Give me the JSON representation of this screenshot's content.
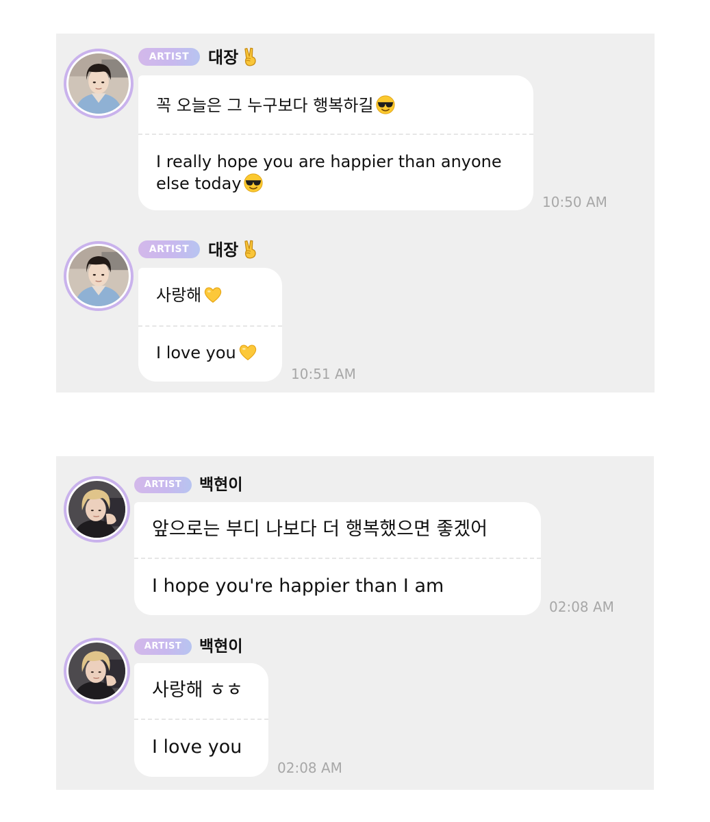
{
  "messages": [
    {
      "badge": "ARTIST",
      "name": "대장",
      "korean": "꼭 오늘은 그 누구보다 행복하길",
      "english": "I really hope you are happier than anyone else today",
      "time": "10:50 AM",
      "name_emoji": "victory-hand-emoji",
      "text_emoji": "sunglasses-face-emoji"
    },
    {
      "badge": "ARTIST",
      "name": "대장",
      "korean": "사랑해",
      "english": "I love you",
      "time": "10:51 AM",
      "name_emoji": "victory-hand-emoji",
      "text_emoji": "yellow-heart-emoji"
    },
    {
      "badge": "ARTIST",
      "name": "백현이",
      "korean": "앞으로는 부디 나보다 더 행복했으면 좋겠어",
      "english": "I hope you're happier than I am",
      "time": "02:08 AM"
    },
    {
      "badge": "ARTIST",
      "name": "백현이",
      "korean": "사랑해 ㅎㅎ",
      "english": "I love you",
      "time": "02:08 AM"
    }
  ],
  "colors": {
    "panel_background": "#efefef",
    "bubble_background": "#ffffff",
    "badge_gradient_start": "#d3b8ea",
    "badge_gradient_end": "#b7c4f0",
    "avatar_ring": "#c9b2ec",
    "timestamp": "#a7a7a7"
  }
}
